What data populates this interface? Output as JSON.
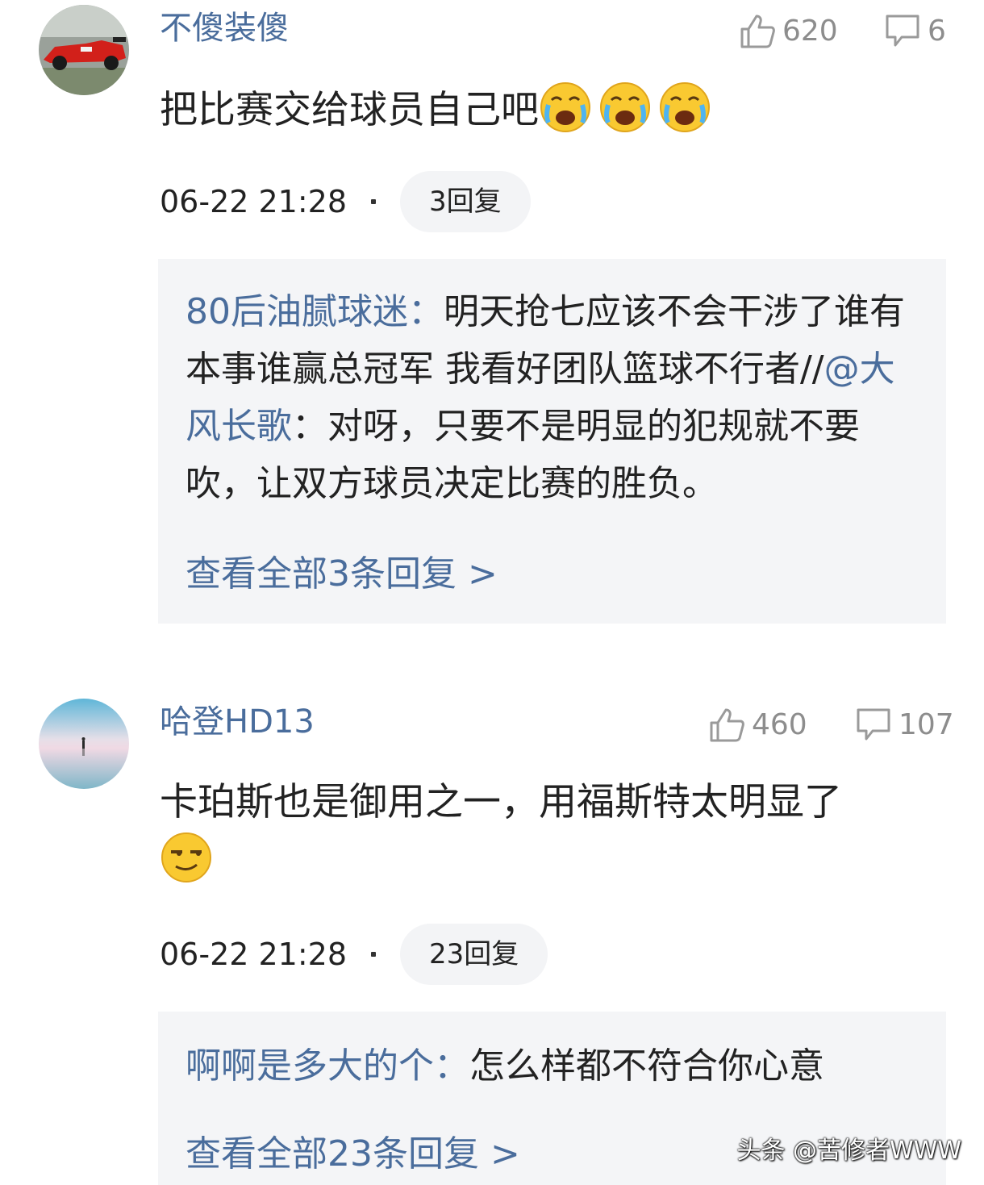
{
  "comments": [
    {
      "username": "不傻装傻",
      "likes": "620",
      "replies_count": "6",
      "text": "把比赛交给球员自己吧",
      "emojis": [
        "crying-face-emoji",
        "crying-face-emoji",
        "crying-face-emoji"
      ],
      "time": "06-22 21:28",
      "reply_button": "3回复",
      "reply_preview": {
        "author": "80后油腻球迷",
        "colon": "：",
        "text_part1": "明天抢七应该不会干涉了谁有本事谁赢总冠军 我看好团队篮球不行者//",
        "mention": "@大风长歌",
        "text_part2": "：对呀，只要不是明显的犯规就不要吹，让双方球员决定比赛的胜负。"
      },
      "view_all": "查看全部3条回复 >"
    },
    {
      "username": "哈登HD13",
      "likes": "460",
      "replies_count": "107",
      "text": "卡珀斯也是御用之一，用福斯特太明显了",
      "emojis": [
        "smirk-face-emoji"
      ],
      "time": "06-22 21:28",
      "reply_button": "23回复",
      "reply_preview": {
        "author": "啊啊是多大的个",
        "colon": "：",
        "text_part1": "怎么样都不符合你心意"
      },
      "view_all": "查看全部23条回复 >"
    }
  ],
  "watermark": "头条 @苦修者WWW",
  "colors": {
    "username": "#4a6d9c",
    "reply_box_bg": "#f4f5f7",
    "icon_gray": "#8d8d8d"
  }
}
